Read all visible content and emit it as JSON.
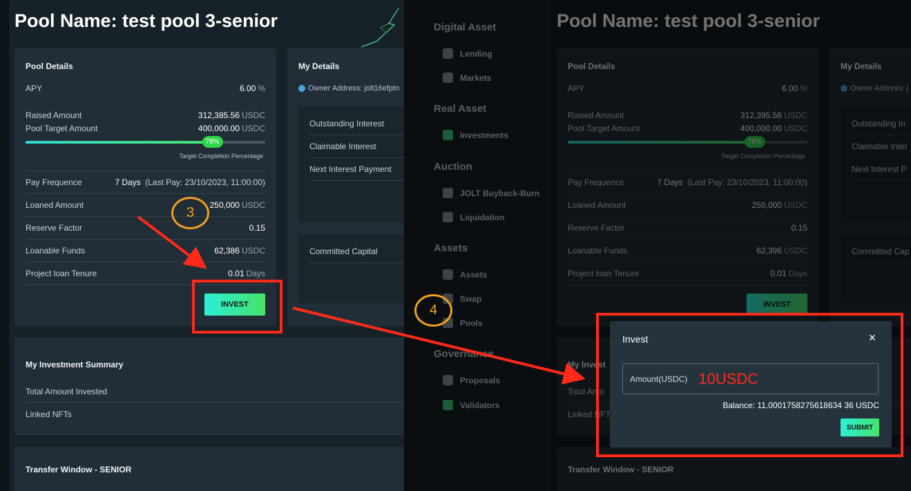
{
  "left": {
    "pool_title": "Pool Name: test pool 3-senior",
    "pool_details": {
      "title": "Pool Details",
      "apy_label": "APY",
      "apy_value": "6.00",
      "apy_unit": "%",
      "raised_label": "Raised Amount",
      "raised_value": "312,385.56",
      "raised_unit": "USDC",
      "target_label": "Pool Target Amount",
      "target_value": "400,000.00",
      "target_unit": "USDC",
      "progress_percent": 78,
      "progress_text": "78%",
      "progress_caption": "Target Completion Percentage",
      "pay_freq_label": "Pay Frequence",
      "pay_freq_value": "7 Days",
      "pay_freq_detail": "(Last Pay: 23/10/2023, 11:00:00)",
      "loaned_label": "Loaned Amount",
      "loaned_value": "250,000",
      "loaned_unit": "USDC",
      "reserve_label": "Reserve Factor",
      "reserve_value": "0.15",
      "loanable_label": "Loanable Funds",
      "loanable_value": "62,386",
      "loanable_unit": "USDC",
      "tenure_label": "Project loan Tenure",
      "tenure_value": "0.01",
      "tenure_unit": "Days",
      "invest_label": "INVEST"
    },
    "my_details": {
      "title": "My Details",
      "owner": "Owner Address: jolt16efptn",
      "rows": [
        "Outstanding Interest",
        "Claimable Interest",
        "Next Interest Payment"
      ],
      "committed": "Committed Capital"
    },
    "summary": {
      "title": "My Investment Summary",
      "rows": [
        "Total Amount Invested",
        "Linked NFTs"
      ]
    },
    "transfer_title": "Transfer Window - SENIOR"
  },
  "right": {
    "pool_title": "Pool Name: test pool 3-senior",
    "sidebar": {
      "sections": [
        {
          "heading": "Digital Asset",
          "items": [
            "Lending",
            "Markets"
          ]
        },
        {
          "heading": "Real Asset",
          "items": [
            "Investments"
          ]
        },
        {
          "heading": "Auction",
          "items": [
            "JOLT Buyback-Burn",
            "Liquidation"
          ]
        },
        {
          "heading": "Assets",
          "items": [
            "Assets",
            "Swap",
            "Pools"
          ]
        },
        {
          "heading": "Governance",
          "items": [
            "Proposals",
            "Validators"
          ]
        }
      ]
    },
    "pool_details": {
      "title": "Pool Details",
      "apy_label": "APY",
      "apy_value": "6.00",
      "apy_unit": "%",
      "raised_label": "Raised Amount",
      "raised_value": "312,395.56",
      "raised_unit": "USDC",
      "target_label": "Pool Target Amount",
      "target_value": "400,000.00",
      "target_unit": "USDC",
      "progress_percent": 78,
      "progress_text": "78%",
      "progress_caption": "Target Completion Percentage",
      "pay_freq_label": "Pay Frequence",
      "pay_freq_value": "7 Days",
      "pay_freq_detail": "(Last Pay: 23/10/2023, 11:00:00)",
      "loaned_label": "Loaned Amount",
      "loaned_value": "250,000",
      "loaned_unit": "USDC",
      "reserve_label": "Reserve Factor",
      "reserve_value": "0.15",
      "loanable_label": "Loanable Funds",
      "loanable_value": "62,396",
      "loanable_unit": "USDC",
      "tenure_label": "Project loan Tenure",
      "tenure_value": "0.01",
      "tenure_unit": "Days",
      "invest_label": "INVEST"
    },
    "my_details": {
      "title": "My Details",
      "owner": "Owner Address: j",
      "rows": [
        "Outstanding In",
        "Claimable Inter",
        "Next Interest P"
      ],
      "committed": "Committed Cap"
    },
    "summary": {
      "title": "My Invest",
      "rows": [
        "Total Amo",
        "Linked NFT"
      ]
    },
    "transfer_title": "Transfer Window - SENIOR",
    "modal": {
      "title": "Invest",
      "close_icon": "×",
      "amount_label": "Amount(USDC)",
      "amount_value": "10USDC",
      "balance": "Balance: 11.0001758275618634 36 USDC",
      "submit_label": "SUBMIT"
    }
  },
  "annotations": {
    "step3": "3",
    "step4": "4",
    "highlight_color": "#ff2a1a",
    "step_color": "#f0a020"
  }
}
